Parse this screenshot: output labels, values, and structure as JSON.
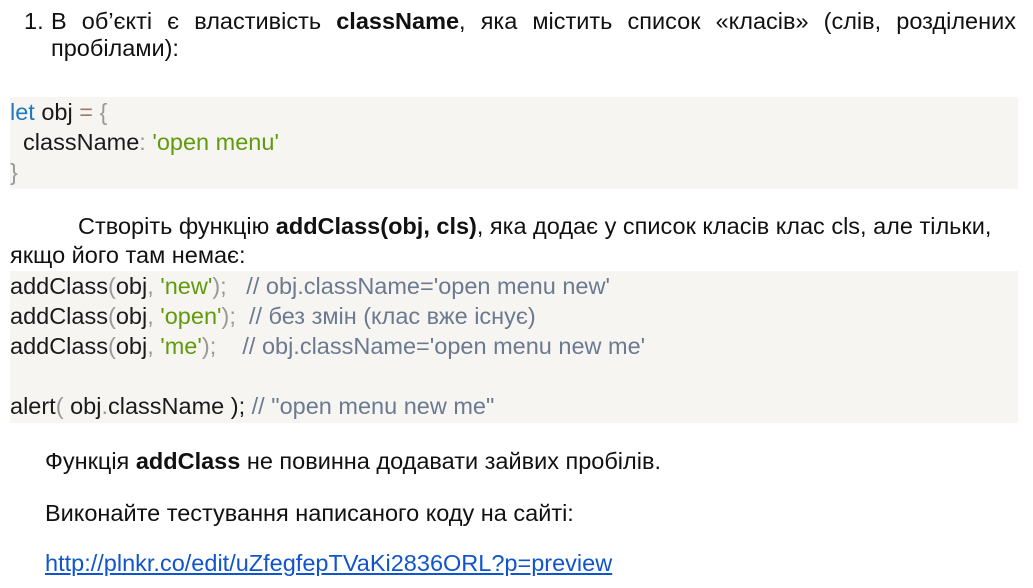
{
  "task_item": {
    "number": "1.",
    "part1": "В об’єкті є властивість ",
    "bold": "className",
    "part2": ", яка містить список «класів» (слів, розділених пробілами):"
  },
  "code_block_1": {
    "kw": "let",
    "var": " obj ",
    "eq": "=",
    "brace_open": " {",
    "prop": "  className",
    "colon": ": ",
    "value": "'open menu'",
    "brace_close": "}"
  },
  "instruction": {
    "part1": "Створіть функцію ",
    "bold": "addClass(obj, cls)",
    "part2": ", яка додає у список класів клас cls, але тільки, якщо його там немає:"
  },
  "code_block_2": {
    "calls": [
      {
        "fn": "addClass",
        "arg1": "obj",
        "arg2": "'new'",
        "end": ");   ",
        "comment": "// obj.className='open menu new'"
      },
      {
        "fn": "addClass",
        "arg1": "obj",
        "arg2": "'open'",
        "end": ");  ",
        "comment": "// без змін (клас вже існує)"
      },
      {
        "fn": "addClass",
        "arg1": "obj",
        "arg2": "'me'",
        "end": ");    ",
        "comment": "// obj.className='open menu new me'"
      }
    ],
    "alert": {
      "fn": "alert",
      "open": "( ",
      "obj": "obj",
      "dot": ".",
      "prop": "className",
      "close": " ); ",
      "comment": "// \"open menu new me\""
    }
  },
  "note": {
    "part1": "Функція ",
    "bold": "addClass",
    "part2": " не повинна додавати зайвих пробілів."
  },
  "testing": {
    "text": "Виконайте тестування написаного коду на сайті:"
  },
  "link": {
    "url": "http://plnkr.co/edit/uZfegfepTVaKi2836ORL?p=preview"
  }
}
